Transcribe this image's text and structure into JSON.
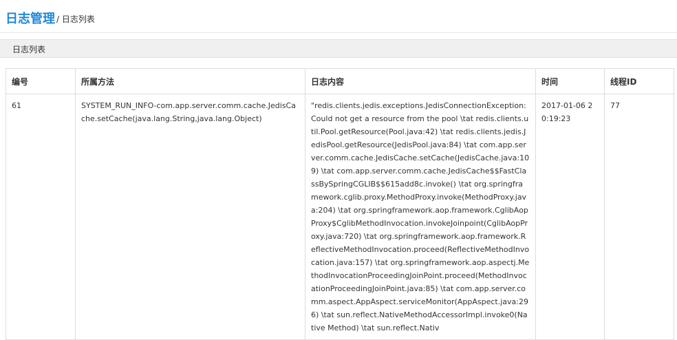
{
  "header": {
    "title": "日志管理",
    "subtitle": "/ 日志列表"
  },
  "breadcrumb": {
    "label": "日志列表"
  },
  "table": {
    "columns": [
      "编号",
      "所属方法",
      "日志内容",
      "时间",
      "线程ID"
    ],
    "rows": [
      {
        "id": "61",
        "method": "SYSTEM_RUN_INFO-com.app.server.comm.cache.JedisCache.setCache(java.lang.String,java.lang.Object)",
        "content": "\"redis.clients.jedis.exceptions.JedisConnectionException: Could not get a resource from the pool \\tat redis.clients.util.Pool.getResource(Pool.java:42) \\tat redis.clients.jedis.JedisPool.getResource(JedisPool.java:84) \\tat com.app.server.comm.cache.JedisCache.setCache(JedisCache.java:109) \\tat com.app.server.comm.cache.JedisCache$$FastClassBySpringCGLIB$$615add8c.invoke() \\tat org.springframework.cglib.proxy.MethodProxy.invoke(MethodProxy.java:204) \\tat org.springframework.aop.framework.CglibAopProxy$CglibMethodInvocation.invokeJoinpoint(CglibAopProxy.java:720) \\tat org.springframework.aop.framework.ReflectiveMethodInvocation.proceed(ReflectiveMethodInvocation.java:157) \\tat org.springframework.aop.aspectj.MethodInvocationProceedingJoinPoint.proceed(MethodInvocationProceedingJoinPoint.java:85) \\tat com.app.server.comm.aspect.AppAspect.serviceMonitor(AppAspect.java:296) \\tat sun.reflect.NativeMethodAccessorImpl.invoke0(Native Method) \\tat sun.reflect.Nativ",
        "time": "2017-01-06 20:19:23",
        "thread_id": "77"
      }
    ]
  }
}
